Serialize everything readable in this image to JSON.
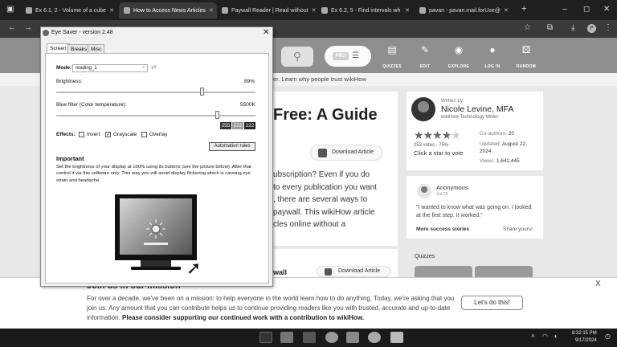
{
  "browser": {
    "tabs": [
      {
        "title": "Ex 6.1, 2 - Volume of a cube"
      },
      {
        "title": "How to Access News Articles"
      },
      {
        "title": "Paywall Reader | Read without"
      },
      {
        "title": "Ex 6.2, 5 - Find intervals wh"
      },
      {
        "title": "pavan - pavan.mail.forUse@"
      }
    ],
    "new_tab_icon": "+",
    "profile_initial": "P"
  },
  "site": {
    "nav": [
      {
        "label": "QUIZZES",
        "icon": "quiz-icon"
      },
      {
        "label": "EDIT",
        "icon": "edit-icon"
      },
      {
        "label": "EXPLORE",
        "icon": "explore-icon"
      },
      {
        "label": "LOG IN",
        "icon": "user-icon"
      },
      {
        "label": "RANDOM",
        "icon": "random-icon"
      }
    ],
    "pro_badge": "PRO",
    "subheader": "er. Learn why people trust wikiHow",
    "article_title": "Free: A Guide",
    "download_label": "Download Article",
    "intro": [
      "ubscription? Even if you do",
      "to every publication you want",
      ", there are several ways to",
      "paywall. This wikiHow article",
      "cles online without a"
    ],
    "section2_title": "wall",
    "download2_label": "Download Article",
    "author": {
      "written_by": "Written by:",
      "name": "Nicole Levine, MFA",
      "role": "wikiHow Technology Writer"
    },
    "rating": {
      "votes": "253 votes - 75%",
      "click": "Click a star to vote",
      "co_authors_label": "Co-authors:",
      "co_authors": "20",
      "updated_label": "Updated:",
      "updated": "August 22, 2024",
      "views_label": "Views:",
      "views": "1,642,445"
    },
    "comment": {
      "name": "Anonymous",
      "date": "Jul 25",
      "text": "\"I wanted to know what was going on. I looked at the first step. It worked.\"",
      "more": "More success stories",
      "share": "Share yours!"
    },
    "quizzes_label": "Quizzes"
  },
  "mission": {
    "title": "Join us in our mission",
    "body_plain": "For over a decade, we've been on a mission: to help everyone in the world learn how to do anything. Today, we're asking that you join us. Any amount that you can contribute helps us to continue providing readers like you with trusted, accurate and up-to-date information.",
    "body_bold": "Please consider supporting our continued work with a contribution to wikiHow.",
    "button": "Let's do this!",
    "close": "X"
  },
  "dialog": {
    "title": "Eye Saver - version 2.48",
    "tabs": [
      "Screen",
      "Breaks",
      "Misc"
    ],
    "mode_label": "Mode:",
    "mode_value": "reading_1",
    "brightness_label": "Brightness:",
    "brightness_value": "89%",
    "brightness_level": 0.89,
    "bluefilter_label": "Blue filter (Color temperature):",
    "bluefilter_value": "5500K",
    "rgb": [
      "255",
      "222",
      "222"
    ],
    "effects_label": "Effects:",
    "effects": [
      {
        "label": "Invert",
        "checked": false
      },
      {
        "label": "Grayscale",
        "checked": true
      },
      {
        "label": "Overlay",
        "checked": false
      }
    ],
    "automation_button": "Automation rules",
    "important_title": "Important",
    "important_text": "Set the brightness of your display at 100% using its buttons (see the picture below). After that control it via this software only. This way you will avoid display flickering which is causing eye strain and headache."
  },
  "taskbar": {
    "time": "8:32:15 PM",
    "date": "9/17/2024"
  }
}
